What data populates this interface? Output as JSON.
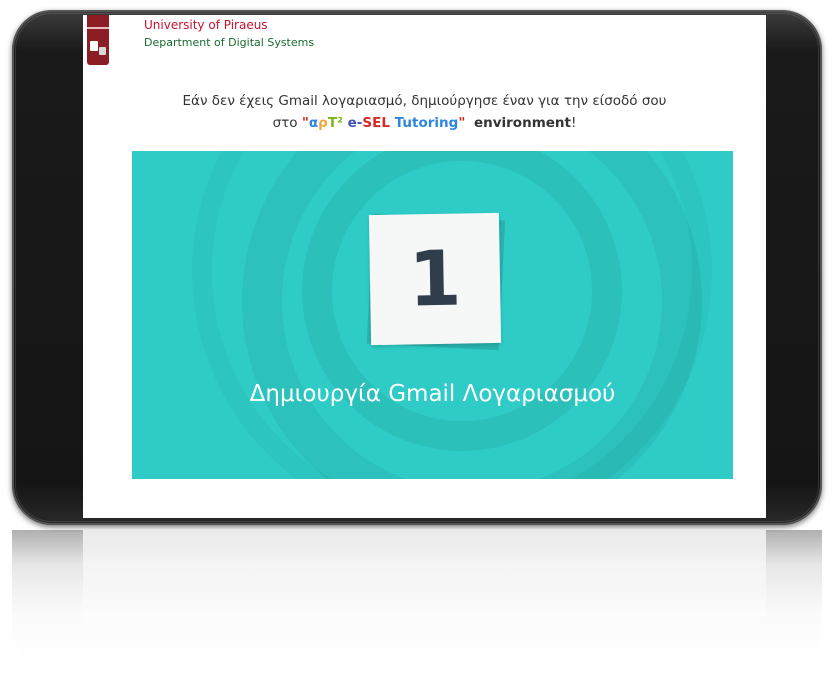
{
  "header": {
    "university": "University of Piraeus",
    "department": "Department of Digital Systems"
  },
  "instruction": {
    "line1": "Εάν δεν έχεις Gmail λογαριασμό, δημιούργησε έναν για την είσοδό σου",
    "line2_prefix": "στο ",
    "brand_quote_open": "\"",
    "brand_a": "α",
    "brand_p": "ρ",
    "brand_t": "T²",
    "brand_e": " e-",
    "brand_sel": "SEL",
    "brand_tut": " Tutoring",
    "brand_quote_close": "\"",
    "env_word": "environment",
    "line2_suffix": "!"
  },
  "video": {
    "number": "1",
    "title": "Δημιουργία Gmail Λογαριασμού"
  },
  "colors": {
    "tile": "#2fccc7",
    "university": "#c8102e",
    "department": "#1a6b2f"
  }
}
